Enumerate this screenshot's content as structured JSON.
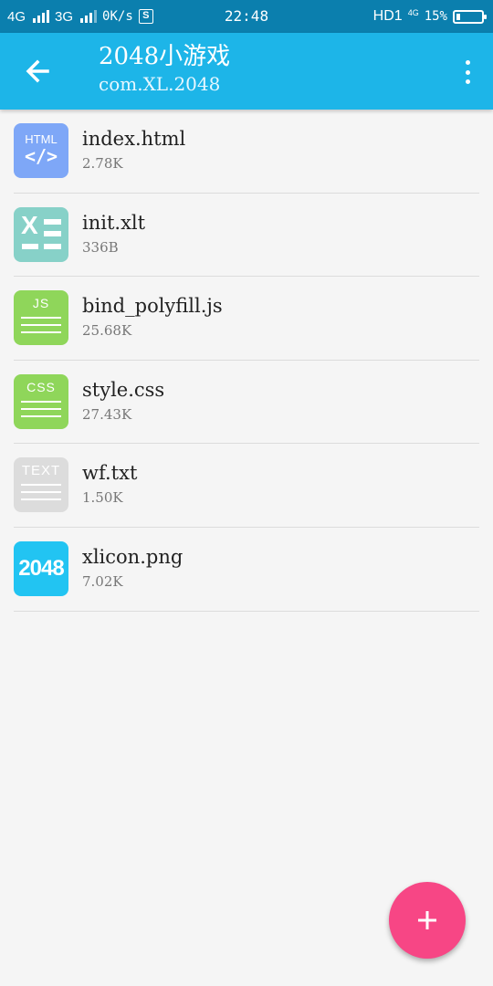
{
  "status_bar": {
    "net1": "4G",
    "net2": "3G",
    "speed": "0K/s",
    "sim_badge": "S",
    "time": "22:48",
    "hd": "HD1",
    "net3": "4G",
    "battery_percent": "15%",
    "battery_level": 0.15
  },
  "app_bar": {
    "title": "2048小游戏",
    "subtitle": "com.XL.2048",
    "back_icon": "arrow-left-icon",
    "menu_icon": "more-vert-icon"
  },
  "files": [
    {
      "name": "index.html",
      "size": "2.78K",
      "icon": "html-file-icon",
      "icon_label": "HTML",
      "icon_glyph": "</>",
      "icon_color": "#7ea7f7"
    },
    {
      "name": "init.xlt",
      "size": "336B",
      "icon": "spreadsheet-file-icon",
      "icon_label": "X",
      "icon_color": "#87d1c8"
    },
    {
      "name": "bind_polyfill.js",
      "size": "25.68K",
      "icon": "js-file-icon",
      "icon_label": "JS",
      "icon_color": "#8fd65a"
    },
    {
      "name": "style.css",
      "size": "27.43K",
      "icon": "css-file-icon",
      "icon_label": "CSS",
      "icon_color": "#8fd65a"
    },
    {
      "name": "wf.txt",
      "size": "1.50K",
      "icon": "text-file-icon",
      "icon_label": "TEXT",
      "icon_color": "#dcdcdc"
    },
    {
      "name": "xlicon.png",
      "size": "7.02K",
      "icon": "image-thumbnail-icon",
      "icon_label": "2048",
      "icon_color": "#22c4f2"
    }
  ],
  "fab": {
    "icon": "plus-icon",
    "color": "#f74685"
  },
  "colors": {
    "status_bar": "#0b7fae",
    "app_bar": "#1db5e8",
    "background": "#f5f5f5"
  }
}
